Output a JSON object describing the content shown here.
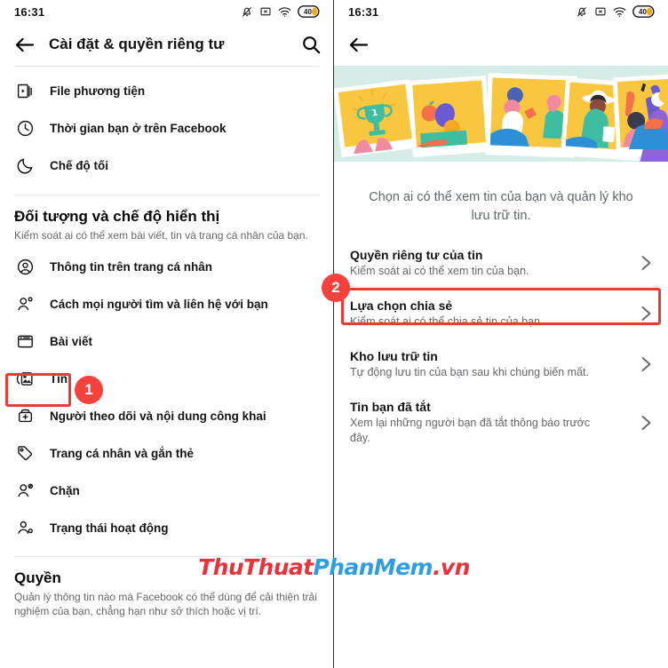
{
  "status_bar": {
    "time": "16:31",
    "battery_level": "40",
    "icons": [
      "bell-muted-icon",
      "x-box-icon",
      "wifi-icon",
      "battery-icon"
    ]
  },
  "colors": {
    "accent_red": "#ea3b35",
    "badge_red": "#f6423c",
    "text_primary": "#141414",
    "text_secondary": "#65676b",
    "divider": "#e4e6eb",
    "hero_bg": "#d6ece6",
    "photo_yellow": "#f8c63f",
    "watermark_red": "#e8333c",
    "watermark_blue": "#2f9ee0"
  },
  "left_panel": {
    "nav": {
      "back_label": "back-arrow",
      "title": "Cài đặt & quyền riêng tư",
      "search_label": "search"
    },
    "top_items": [
      {
        "label": "File phương tiện",
        "icon": "media-files-icon"
      },
      {
        "label": "Thời gian bạn ở trên Facebook",
        "icon": "clock-icon"
      },
      {
        "label": "Chế độ tối",
        "icon": "moon-icon"
      }
    ],
    "section_audience": {
      "title": "Đối tượng và chế độ hiển thị",
      "subtitle": "Kiểm soát ai có thể xem bài viết, tin và trang cá nhân của bạn."
    },
    "audience_items": [
      {
        "label": "Thông tin trên trang cá nhân",
        "icon": "profile-info-icon"
      },
      {
        "label": "Cách mọi người tìm và liên hệ với bạn",
        "icon": "person-search-icon"
      },
      {
        "label": "Bài viết",
        "icon": "posts-icon"
      },
      {
        "label": "Tin",
        "icon": "stories-icon"
      },
      {
        "label": "Người theo dõi và nội dung công khai",
        "icon": "followers-icon"
      },
      {
        "label": "Trang cá nhân và gắn thẻ",
        "icon": "tag-icon"
      },
      {
        "label": "Chặn",
        "icon": "block-icon"
      },
      {
        "label": "Trạng thái hoạt động",
        "icon": "active-status-icon"
      }
    ],
    "section_permissions": {
      "title": "Quyền",
      "subtitle": "Quản lý thông tin nào mà Facebook có thể dùng để cải thiện trải nghiệm của bạn, chẳng hạn như sở thích hoặc vị trí."
    }
  },
  "right_panel": {
    "nav": {
      "back_label": "back-arrow"
    },
    "hero_caption": "Chọn ai có thể xem tin của bạn và quản lý kho lưu trữ tin.",
    "options": [
      {
        "title": "Quyền riêng tư của tin",
        "subtitle": "Kiểm soát ai có thể xem tin của bạn.",
        "chevron": "chevron-right-icon"
      },
      {
        "title": "Lựa chọn chia sẻ",
        "subtitle": "Kiểm soát ai có thể chia sẻ tin của bạn.",
        "chevron": "chevron-right-icon"
      },
      {
        "title": "Kho lưu trữ tin",
        "subtitle": "Tự động lưu tin của bạn sau khi chúng biến mất.",
        "chevron": "chevron-right-icon"
      },
      {
        "title": "Tin bạn đã tắt",
        "subtitle": "Xem lại những người bạn đã tắt thông báo trước đây.",
        "chevron": "chevron-right-icon"
      }
    ]
  },
  "annotations": {
    "badge_1": "1",
    "badge_2": "2"
  },
  "watermark": {
    "part1": "ThuThuat",
    "part2": "PhanMem",
    "part3": ".vn"
  }
}
